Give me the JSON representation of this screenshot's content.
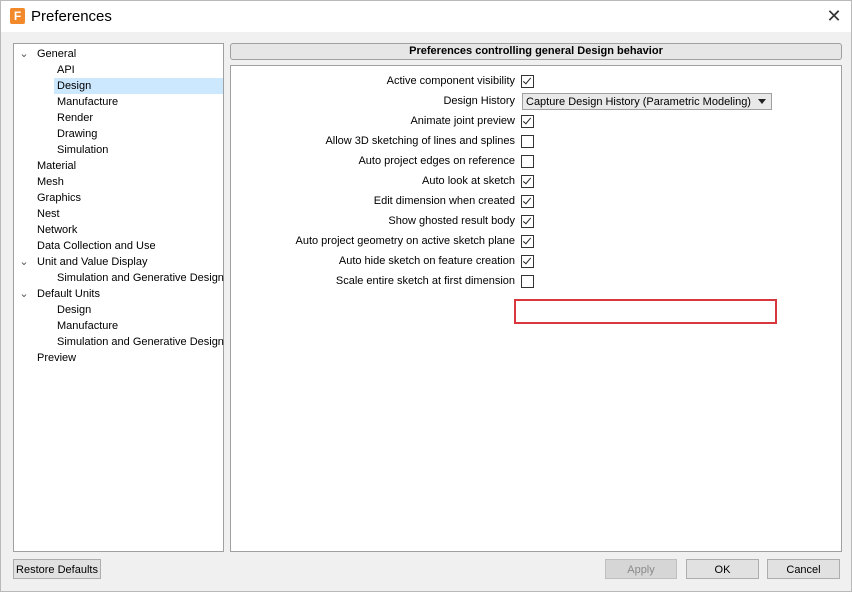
{
  "window": {
    "title": "Preferences",
    "app_icon": "F"
  },
  "tree": {
    "items": [
      {
        "label": "General",
        "expanded": true,
        "level": 0
      },
      {
        "label": "API",
        "level": 1
      },
      {
        "label": "Design",
        "level": 1,
        "selected": true
      },
      {
        "label": "Manufacture",
        "level": 1
      },
      {
        "label": "Render",
        "level": 1
      },
      {
        "label": "Drawing",
        "level": 1
      },
      {
        "label": "Simulation",
        "level": 1
      },
      {
        "label": "Material",
        "level": 0
      },
      {
        "label": "Mesh",
        "level": 0
      },
      {
        "label": "Graphics",
        "level": 0
      },
      {
        "label": "Nest",
        "level": 0
      },
      {
        "label": "Network",
        "level": 0
      },
      {
        "label": "Data Collection and Use",
        "level": 0
      },
      {
        "label": "Unit and Value Display",
        "expanded": true,
        "level": 0
      },
      {
        "label": "Simulation and Generative Design",
        "level": 1
      },
      {
        "label": "Default Units",
        "expanded": true,
        "level": 0
      },
      {
        "label": "Design",
        "level": 1
      },
      {
        "label": "Manufacture",
        "level": 1
      },
      {
        "label": "Simulation and Generative Design",
        "level": 1
      },
      {
        "label": "Preview",
        "level": 0
      }
    ]
  },
  "panel": {
    "header": "Preferences controlling general Design behavior",
    "settings": [
      {
        "label": "Active component visibility",
        "type": "checkbox",
        "checked": true
      },
      {
        "label": "Design History",
        "type": "dropdown",
        "value": "Capture Design History (Parametric Modeling)"
      },
      {
        "label": "Animate joint preview",
        "type": "checkbox",
        "checked": true
      },
      {
        "label": "Allow 3D sketching of lines and splines",
        "type": "checkbox",
        "checked": false
      },
      {
        "label": "Auto project edges on reference",
        "type": "checkbox",
        "checked": false
      },
      {
        "label": "Auto look at sketch",
        "type": "checkbox",
        "checked": true
      },
      {
        "label": "Edit dimension when created",
        "type": "checkbox",
        "checked": true
      },
      {
        "label": "Show ghosted result body",
        "type": "checkbox",
        "checked": true
      },
      {
        "label": "Auto project geometry on active sketch plane",
        "type": "checkbox",
        "checked": true,
        "highlighted": true
      },
      {
        "label": "Auto hide sketch on feature creation",
        "type": "checkbox",
        "checked": true
      },
      {
        "label": "Scale entire sketch at first dimension",
        "type": "checkbox",
        "checked": false
      }
    ]
  },
  "buttons": {
    "restore": "Restore Defaults",
    "apply": "Apply",
    "ok": "OK",
    "cancel": "Cancel"
  },
  "colors": {
    "selection": "#cce8ff",
    "highlight": "#d9363e",
    "icon": "#f28a2c"
  }
}
